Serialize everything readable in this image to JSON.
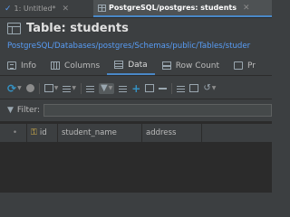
{
  "editor_tabs": [
    {
      "label": "1: Untitled*",
      "icon": "pen-icon"
    },
    {
      "label": "PostgreSQL/postgres: students",
      "icon": "table-icon"
    }
  ],
  "page": {
    "title": "Table: students",
    "breadcrumb": "PostgreSQL/Databases/postgres/Schemas/public/Tables/studer"
  },
  "sub_tabs": [
    {
      "label": "Info",
      "icon": "info-icon"
    },
    {
      "label": "Columns",
      "icon": "columns-icon"
    },
    {
      "label": "Data",
      "icon": "data-grid-icon",
      "active": true
    },
    {
      "label": "Row Count",
      "icon": "row-count-icon"
    },
    {
      "label": "Pr",
      "icon": "properties-icon"
    }
  ],
  "filter": {
    "label": "Filter:",
    "value": ""
  },
  "grid": {
    "row_marker": "•",
    "columns": [
      "id",
      "student_name",
      "address"
    ],
    "key_column": "id"
  },
  "colors": {
    "accent": "#4a88c7",
    "link": "#589df6",
    "background": "#3c3f41",
    "grid_background": "#2b2b2b"
  }
}
